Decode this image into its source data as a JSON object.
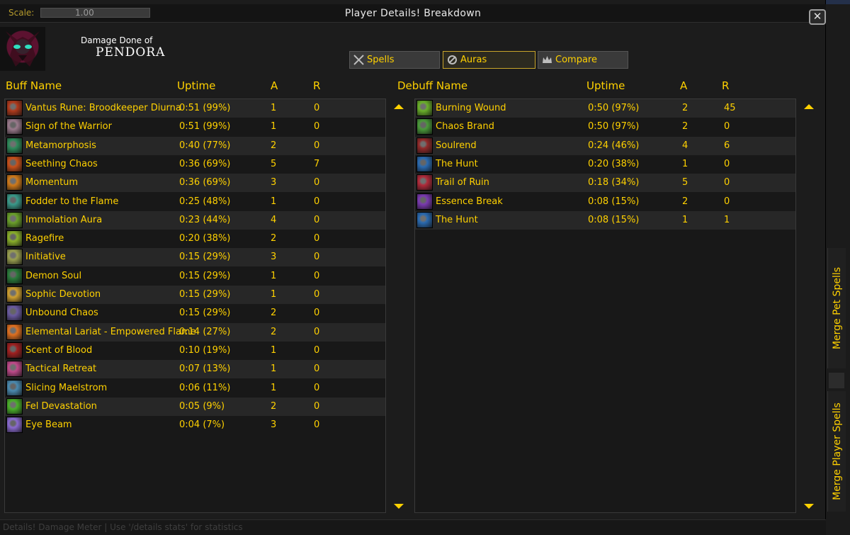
{
  "window": {
    "scale_label": "Scale:",
    "scale_value": "1.00",
    "title": "Player Details! Breakdown",
    "close_glyph": "✕"
  },
  "header": {
    "label": "Damage Done of",
    "player_name": "PENDORA"
  },
  "tabs": [
    {
      "label": "Spells",
      "icon": "swords-icon",
      "active": false
    },
    {
      "label": "Auras",
      "icon": "aura-icon",
      "active": true
    },
    {
      "label": "Compare",
      "icon": "crown-icon",
      "active": false
    }
  ],
  "buffs": {
    "columns": {
      "name": "Buff Name",
      "uptime": "Uptime",
      "a": "A",
      "r": "R"
    },
    "rows": [
      {
        "name": "Vantus Rune: Broodkeeper Diurna",
        "uptime": "0:51 (99%)",
        "a": "1",
        "r": "0",
        "color": "#b03a1c"
      },
      {
        "name": "Sign of the Warrior",
        "uptime": "0:51 (99%)",
        "a": "1",
        "r": "0",
        "color": "#9a7a8c"
      },
      {
        "name": "Metamorphosis",
        "uptime": "0:40 (77%)",
        "a": "2",
        "r": "0",
        "color": "#2e8a5a"
      },
      {
        "name": "Seething Chaos",
        "uptime": "0:36 (69%)",
        "a": "5",
        "r": "7",
        "color": "#c8501a"
      },
      {
        "name": "Momentum",
        "uptime": "0:36 (69%)",
        "a": "3",
        "r": "0",
        "color": "#d07a1a"
      },
      {
        "name": "Fodder to the Flame",
        "uptime": "0:25 (48%)",
        "a": "1",
        "r": "0",
        "color": "#3a9a8a"
      },
      {
        "name": "Immolation Aura",
        "uptime": "0:23 (44%)",
        "a": "4",
        "r": "0",
        "color": "#6aa02a"
      },
      {
        "name": "Ragefire",
        "uptime": "0:20 (38%)",
        "a": "2",
        "r": "0",
        "color": "#8ab02a"
      },
      {
        "name": "Initiative",
        "uptime": "0:15 (29%)",
        "a": "3",
        "r": "0",
        "color": "#9aa050"
      },
      {
        "name": "Demon Soul",
        "uptime": "0:15 (29%)",
        "a": "1",
        "r": "0",
        "color": "#2a7a3a"
      },
      {
        "name": "Sophic Devotion",
        "uptime": "0:15 (29%)",
        "a": "1",
        "r": "0",
        "color": "#d0a030"
      },
      {
        "name": "Unbound Chaos",
        "uptime": "0:15 (29%)",
        "a": "2",
        "r": "0",
        "color": "#6a5aa0"
      },
      {
        "name": "Elemental Lariat - Empowered Flame",
        "uptime": "0:14 (27%)",
        "a": "2",
        "r": "0",
        "color": "#e07020"
      },
      {
        "name": "Scent of Blood",
        "uptime": "0:10 (19%)",
        "a": "1",
        "r": "0",
        "color": "#a02020"
      },
      {
        "name": "Tactical Retreat",
        "uptime": "0:07 (13%)",
        "a": "1",
        "r": "0",
        "color": "#c04a8a"
      },
      {
        "name": "Slicing Maelstrom",
        "uptime": "0:06 (11%)",
        "a": "1",
        "r": "0",
        "color": "#4a8ab0"
      },
      {
        "name": "Fel Devastation",
        "uptime": "0:05 (9%)",
        "a": "2",
        "r": "0",
        "color": "#4ab02a"
      },
      {
        "name": "Eye Beam",
        "uptime": "0:04 (7%)",
        "a": "3",
        "r": "0",
        "color": "#8a6ad0"
      }
    ]
  },
  "debuffs": {
    "columns": {
      "name": "Debuff Name",
      "uptime": "Uptime",
      "a": "A",
      "r": "R"
    },
    "rows": [
      {
        "name": "Burning Wound",
        "uptime": "0:50 (97%)",
        "a": "2",
        "r": "45",
        "color": "#6ab02a"
      },
      {
        "name": "Chaos Brand",
        "uptime": "0:50 (97%)",
        "a": "2",
        "r": "0",
        "color": "#4a9a3a"
      },
      {
        "name": "Soulrend",
        "uptime": "0:24 (46%)",
        "a": "4",
        "r": "6",
        "color": "#902a2a"
      },
      {
        "name": "The Hunt",
        "uptime": "0:20 (38%)",
        "a": "1",
        "r": "0",
        "color": "#2a6ab0"
      },
      {
        "name": "Trail of Ruin",
        "uptime": "0:18 (34%)",
        "a": "5",
        "r": "0",
        "color": "#b02a3a"
      },
      {
        "name": "Essence Break",
        "uptime": "0:08 (15%)",
        "a": "2",
        "r": "0",
        "color": "#7a3ab0"
      },
      {
        "name": "The Hunt",
        "uptime": "0:08 (15%)",
        "a": "1",
        "r": "1",
        "color": "#2a6ab0"
      }
    ]
  },
  "side": {
    "merge_pet": "Merge Pet Spells",
    "merge_player": "Merge Player Spells"
  },
  "status": {
    "text": "Details! Damage Meter | Use '/details stats' for statistics"
  },
  "colors": {
    "accent": "#ffd100",
    "active_tab_border": "#c9a52a",
    "row_alt": "#272727",
    "panel_bg": "#181818"
  }
}
